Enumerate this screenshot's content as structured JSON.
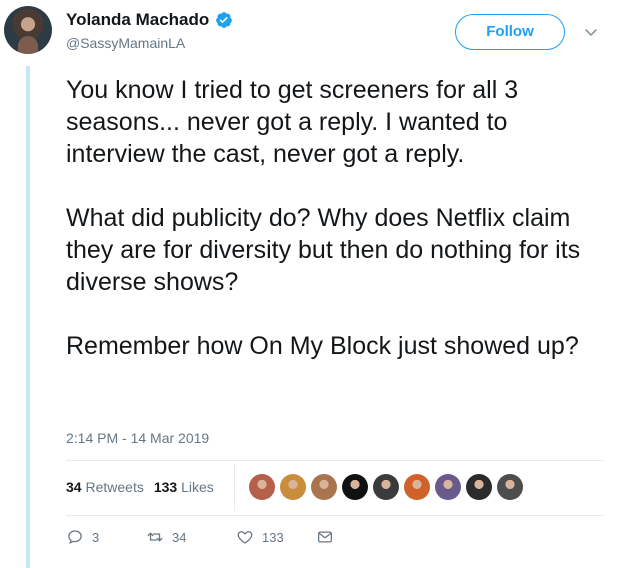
{
  "author": {
    "display_name": "Yolanda Machado",
    "handle": "@SassyMamainLA",
    "verified": true
  },
  "follow_button": {
    "label": "Follow"
  },
  "tweet": {
    "paragraphs": [
      "You know I tried to get screeners for all 3 seasons... never got a reply. I wanted to interview the cast, never got a reply.",
      "What did publicity do? Why does Netflix claim they are for diversity but then do nothing for its diverse shows?",
      "Remember how On My Block just showed up?"
    ],
    "timestamp": "2:14 PM - 14 Mar 2019"
  },
  "stats": {
    "retweets_count": "34",
    "retweets_label": "Retweets",
    "likes_count": "133",
    "likes_label": "Likes"
  },
  "actions": {
    "reply_count": "3",
    "retweet_count": "34",
    "like_count": "133"
  },
  "likers": [
    {
      "icon": "liker-avatar-1",
      "color": "#b5604a"
    },
    {
      "icon": "liker-avatar-2",
      "color": "#c98d3c"
    },
    {
      "icon": "liker-avatar-3",
      "color": "#a8754f"
    },
    {
      "icon": "liker-avatar-4",
      "color": "#111111"
    },
    {
      "icon": "liker-avatar-5",
      "color": "#3b3b3b"
    },
    {
      "icon": "liker-avatar-6",
      "color": "#d0612b"
    },
    {
      "icon": "liker-avatar-7",
      "color": "#6a5a8c"
    },
    {
      "icon": "liker-avatar-8",
      "color": "#2b2b2b"
    },
    {
      "icon": "liker-avatar-9",
      "color": "#4d4d4d"
    }
  ],
  "colors": {
    "accent": "#1da1f2",
    "secondary_text": "#657786",
    "thread_line": "#c4e8f8"
  }
}
